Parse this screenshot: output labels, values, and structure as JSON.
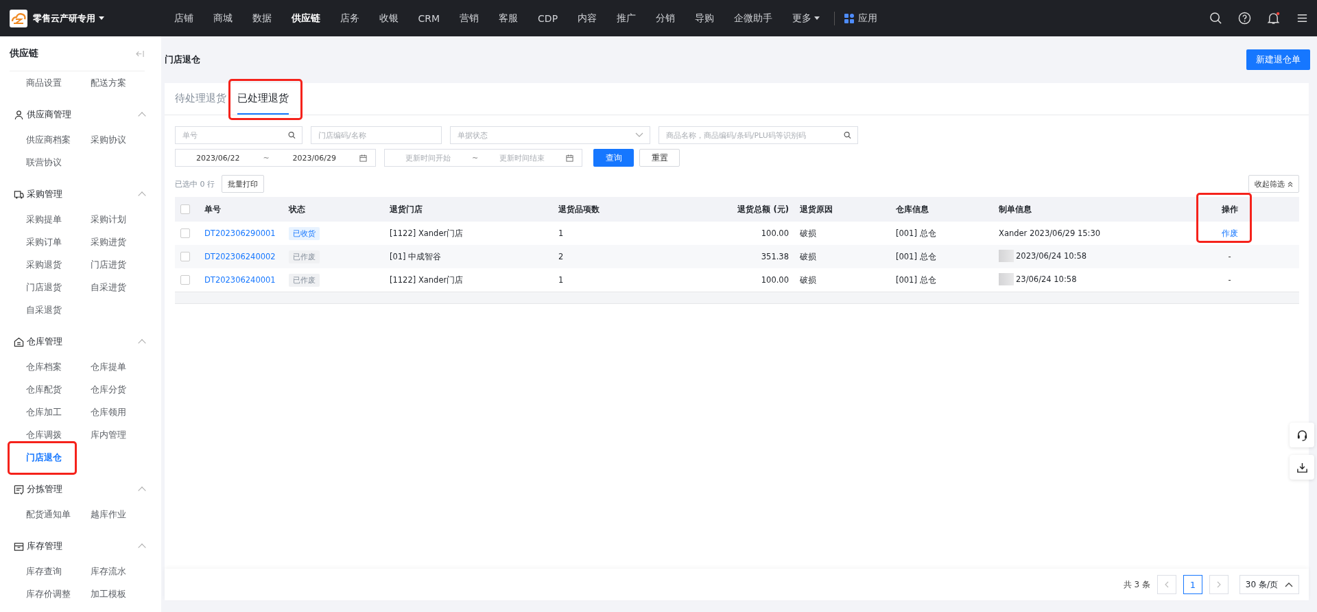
{
  "top_bar": {
    "org": "零售云产研专用",
    "nav": [
      {
        "label": "店铺",
        "selected": false
      },
      {
        "label": "商城",
        "selected": false
      },
      {
        "label": "数据",
        "selected": false
      },
      {
        "label": "供应链",
        "selected": true
      },
      {
        "label": "店务",
        "selected": false
      },
      {
        "label": "收银",
        "selected": false
      },
      {
        "label": "CRM",
        "selected": false
      },
      {
        "label": "营销",
        "selected": false
      },
      {
        "label": "客服",
        "selected": false
      },
      {
        "label": "CDP",
        "selected": false
      },
      {
        "label": "内容",
        "selected": false
      },
      {
        "label": "推广",
        "selected": false
      },
      {
        "label": "分销",
        "selected": false
      },
      {
        "label": "导购",
        "selected": false
      },
      {
        "label": "企微助手",
        "selected": false
      }
    ],
    "more": "更多",
    "apps": "应用",
    "notification_unread": true
  },
  "sidebar": {
    "title": "供应链",
    "groups": [
      {
        "items": [
          {
            "label": "商品设置",
            "selected": false
          },
          {
            "label": "配送方案",
            "selected": false
          }
        ]
      },
      {
        "title": "供应商管理",
        "expanded": true,
        "items": [
          {
            "label": "供应商档案",
            "selected": false
          },
          {
            "label": "采购协议",
            "selected": false
          },
          {
            "label": "联营协议",
            "selected": false
          }
        ]
      },
      {
        "title": "采购管理",
        "expanded": true,
        "items": [
          {
            "label": "采购提单",
            "selected": false
          },
          {
            "label": "采购计划",
            "selected": false
          },
          {
            "label": "采购订单",
            "selected": false
          },
          {
            "label": "采购进货",
            "selected": false
          },
          {
            "label": "采购退货",
            "selected": false
          },
          {
            "label": "门店进货",
            "selected": false
          },
          {
            "label": "门店退货",
            "selected": false
          },
          {
            "label": "自采进货",
            "selected": false
          },
          {
            "label": "自采退货",
            "selected": false
          }
        ]
      },
      {
        "title": "仓库管理",
        "expanded": true,
        "items": [
          {
            "label": "仓库档案",
            "selected": false
          },
          {
            "label": "仓库提单",
            "selected": false
          },
          {
            "label": "仓库配货",
            "selected": false
          },
          {
            "label": "仓库分货",
            "selected": false
          },
          {
            "label": "仓库加工",
            "selected": false
          },
          {
            "label": "仓库领用",
            "selected": false
          },
          {
            "label": "仓库调拨",
            "selected": false
          },
          {
            "label": "库内管理",
            "selected": false
          },
          {
            "label": "门店退仓",
            "selected": true
          }
        ]
      },
      {
        "title": "分拣管理",
        "expanded": true,
        "items": [
          {
            "label": "配货通知单",
            "selected": false
          },
          {
            "label": "越库作业",
            "selected": false
          }
        ]
      },
      {
        "title": "库存管理",
        "expanded": true,
        "items": [
          {
            "label": "库存查询",
            "selected": false
          },
          {
            "label": "库存流水",
            "selected": false
          },
          {
            "label": "库存价调整",
            "selected": false
          },
          {
            "label": "加工模板",
            "selected": false
          }
        ]
      }
    ]
  },
  "page": {
    "title": "门店退仓",
    "new_button": "新建退仓单"
  },
  "tabs": [
    {
      "label": "待处理退货",
      "selected": false
    },
    {
      "label": "已处理退货",
      "selected": true
    }
  ],
  "highlight_frames": {
    "selected_tab": true,
    "selected_sidebar_item": true,
    "action_column": true
  },
  "filters": {
    "order_no": {
      "placeholder": "单号"
    },
    "store": {
      "placeholder": "门店编码/名称"
    },
    "status": {
      "placeholder": "单据状态"
    },
    "product": {
      "placeholder": "商品名称，商品编码/条码/PLU码等识别码"
    },
    "date_range": {
      "start": "2023/06/22",
      "separator": "~",
      "end": "2023/06/29"
    },
    "update_range": {
      "start_placeholder": "更新时间开始",
      "separator": "~",
      "end_placeholder": "更新时间结束"
    },
    "query_button": "查询",
    "reset_button": "重置"
  },
  "toolbar": {
    "selected_count": "已选中 0 行",
    "batch_print": "批量打印",
    "collapse_filters": "收起筛选"
  },
  "table": {
    "all_checked": false,
    "columns": [
      "单号",
      "状态",
      "退货门店",
      "退货品项数",
      "退货总额 (元)",
      "退货原因",
      "仓库信息",
      "制单信息",
      "操作"
    ],
    "rows": [
      {
        "checked": false,
        "order_no": "DT202306290001",
        "status": {
          "text": "已收货",
          "kind": "received"
        },
        "store": "[1122] Xander门店",
        "item_count": "1",
        "amount": "100.00",
        "reason": "破损",
        "warehouse": "[001] 总仓",
        "creator_redacted": false,
        "creator": "Xander 2023/06/29 15:30",
        "action": {
          "text": "作废",
          "kind": "link"
        }
      },
      {
        "checked": false,
        "order_no": "DT202306240002",
        "status": {
          "text": "已作废",
          "kind": "void"
        },
        "store": "[01] 中成智谷",
        "item_count": "2",
        "amount": "351.38",
        "reason": "破损",
        "warehouse": "[001] 总仓",
        "creator_redacted": true,
        "creator": "2023/06/24 10:58",
        "action": {
          "text": "-",
          "kind": "none"
        }
      },
      {
        "checked": false,
        "order_no": "DT202306240001",
        "status": {
          "text": "已作废",
          "kind": "void"
        },
        "store": "[1122] Xander门店",
        "item_count": "1",
        "amount": "100.00",
        "reason": "破损",
        "warehouse": "[001] 总仓",
        "creator_redacted": true,
        "creator": "23/06/24 10:58",
        "action": {
          "text": "-",
          "kind": "none"
        }
      }
    ]
  },
  "pagination": {
    "total": "共 3 条",
    "pages": [
      {
        "label": "1",
        "selected": true
      }
    ],
    "page_size": "30 条/页"
  }
}
